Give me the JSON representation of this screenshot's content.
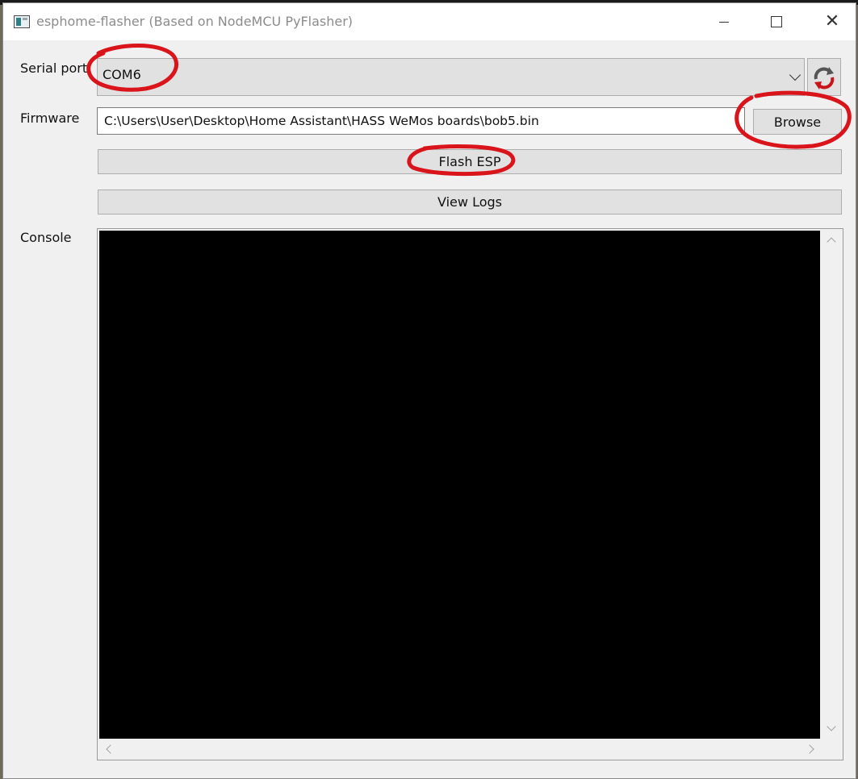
{
  "window": {
    "title": "esphome-flasher (Based on NodeMCU PyFlasher)",
    "icon": "app-window-icon"
  },
  "serial_port": {
    "label": "Serial port",
    "selected": "COM6",
    "refresh_icon": "refresh-arrows-icon"
  },
  "firmware": {
    "label": "Firmware",
    "path": "C:\\Users\\User\\Desktop\\Home Assistant\\HASS WeMos boards\\bob5.bin",
    "browse_label": "Browse"
  },
  "actions": {
    "flash_label": "Flash ESP",
    "logs_label": "View Logs"
  },
  "console": {
    "label": "Console",
    "content": ""
  },
  "colors": {
    "annotation_red": "#d9141b",
    "console_bg": "#000000",
    "window_bg": "#f0f0f0"
  }
}
